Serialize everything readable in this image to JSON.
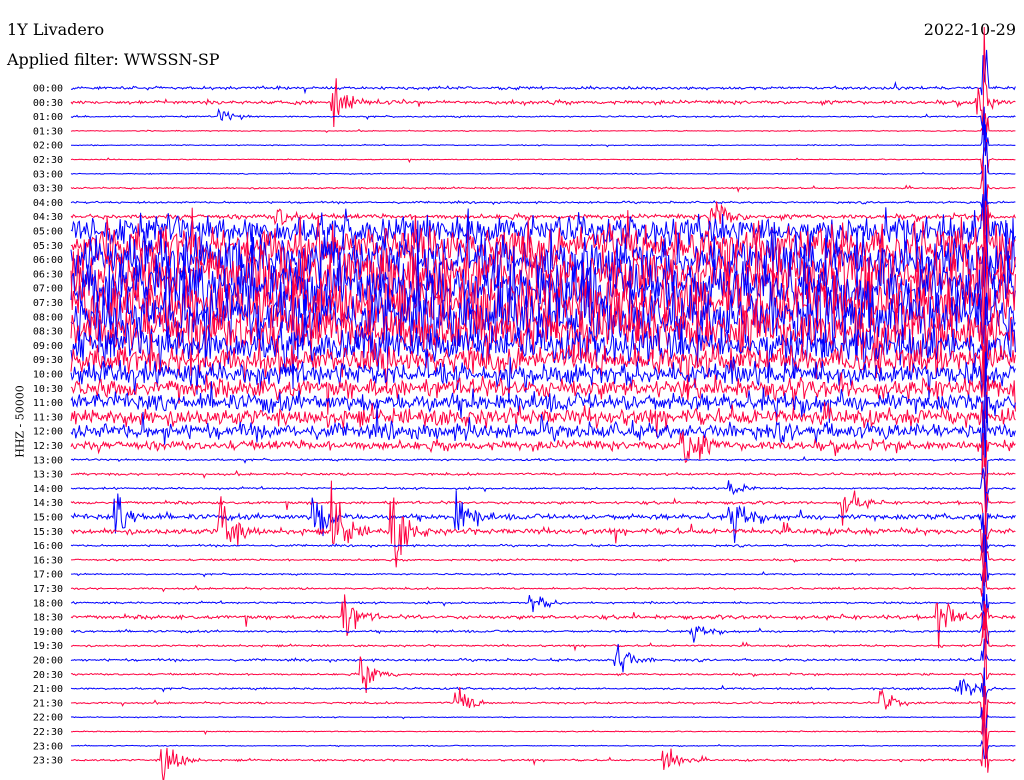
{
  "header": {
    "station": "1Y Livadero",
    "filter": "Applied filter: WWSSN-SP",
    "date": "2022-10-29"
  },
  "chart_data": {
    "type": "line",
    "title": "1Y Livadero",
    "subtitle": "Applied filter: WWSSN-SP",
    "ylabel": "HHZ - 50000",
    "xlabel": "",
    "row_minutes": 30,
    "colors": {
      "even": "#0000ff",
      "odd": "#ff0040"
    },
    "rows": [
      "00:00",
      "00:30",
      "01:00",
      "01:30",
      "02:00",
      "02:30",
      "03:00",
      "03:30",
      "04:00",
      "04:30",
      "05:00",
      "05:30",
      "06:00",
      "06:30",
      "07:00",
      "07:30",
      "08:00",
      "08:30",
      "09:00",
      "09:30",
      "10:00",
      "10:30",
      "11:00",
      "11:30",
      "12:00",
      "12:30",
      "13:00",
      "13:30",
      "14:00",
      "14:30",
      "15:00",
      "15:30",
      "16:00",
      "16:30",
      "17:00",
      "17:30",
      "18:00",
      "18:30",
      "19:00",
      "19:30",
      "20:00",
      "20:30",
      "21:00",
      "21:30",
      "22:00",
      "22:30",
      "23:00",
      "23:30"
    ],
    "noise_amplitude": [
      0.15,
      0.2,
      0.08,
      0.05,
      0.05,
      0.05,
      0.05,
      0.08,
      0.1,
      0.25,
      1.6,
      2.2,
      2.6,
      3.0,
      3.0,
      3.0,
      3.0,
      2.6,
      2.0,
      1.5,
      1.2,
      1.0,
      1.0,
      0.9,
      0.8,
      0.5,
      0.1,
      0.12,
      0.1,
      0.15,
      0.3,
      0.3,
      0.1,
      0.1,
      0.08,
      0.1,
      0.1,
      0.2,
      0.12,
      0.1,
      0.12,
      0.1,
      0.1,
      0.1,
      0.05,
      0.05,
      0.05,
      0.1
    ],
    "events": [
      {
        "row": 1,
        "t": 0.28,
        "amp": 1.2
      },
      {
        "row": 1,
        "t": 0.96,
        "amp": 1.0
      },
      {
        "row": 2,
        "t": 0.16,
        "amp": 0.4
      },
      {
        "row": 9,
        "t": 0.22,
        "amp": 0.8
      },
      {
        "row": 9,
        "t": 0.68,
        "amp": 1.5
      },
      {
        "row": 25,
        "t": 0.65,
        "amp": 1.5
      },
      {
        "row": 28,
        "t": 0.7,
        "amp": 0.5
      },
      {
        "row": 29,
        "t": 0.82,
        "amp": 1.0
      },
      {
        "row": 30,
        "t": 0.05,
        "amp": 1.2
      },
      {
        "row": 30,
        "t": 0.26,
        "amp": 1.8
      },
      {
        "row": 30,
        "t": 0.41,
        "amp": 1.4
      },
      {
        "row": 30,
        "t": 0.7,
        "amp": 1.4
      },
      {
        "row": 31,
        "t": 0.16,
        "amp": 2.2
      },
      {
        "row": 31,
        "t": 0.28,
        "amp": 2.0
      },
      {
        "row": 31,
        "t": 0.34,
        "amp": 2.5
      },
      {
        "row": 37,
        "t": 0.29,
        "amp": 1.5
      },
      {
        "row": 37,
        "t": 0.92,
        "amp": 1.6
      },
      {
        "row": 36,
        "t": 0.49,
        "amp": 0.6
      },
      {
        "row": 38,
        "t": 0.66,
        "amp": 0.5
      },
      {
        "row": 40,
        "t": 0.58,
        "amp": 1.2
      },
      {
        "row": 41,
        "t": 0.31,
        "amp": 1.3
      },
      {
        "row": 42,
        "t": 0.94,
        "amp": 0.8
      },
      {
        "row": 43,
        "t": 0.41,
        "amp": 1.0
      },
      {
        "row": 43,
        "t": 0.86,
        "amp": 1.2
      },
      {
        "row": 47,
        "t": 0.1,
        "amp": 1.5
      },
      {
        "row": 47,
        "t": 0.63,
        "amp": 1.0
      }
    ],
    "large_event": {
      "t": 0.967,
      "from_row": 0,
      "to_row": 47,
      "amp": 3.0
    }
  }
}
